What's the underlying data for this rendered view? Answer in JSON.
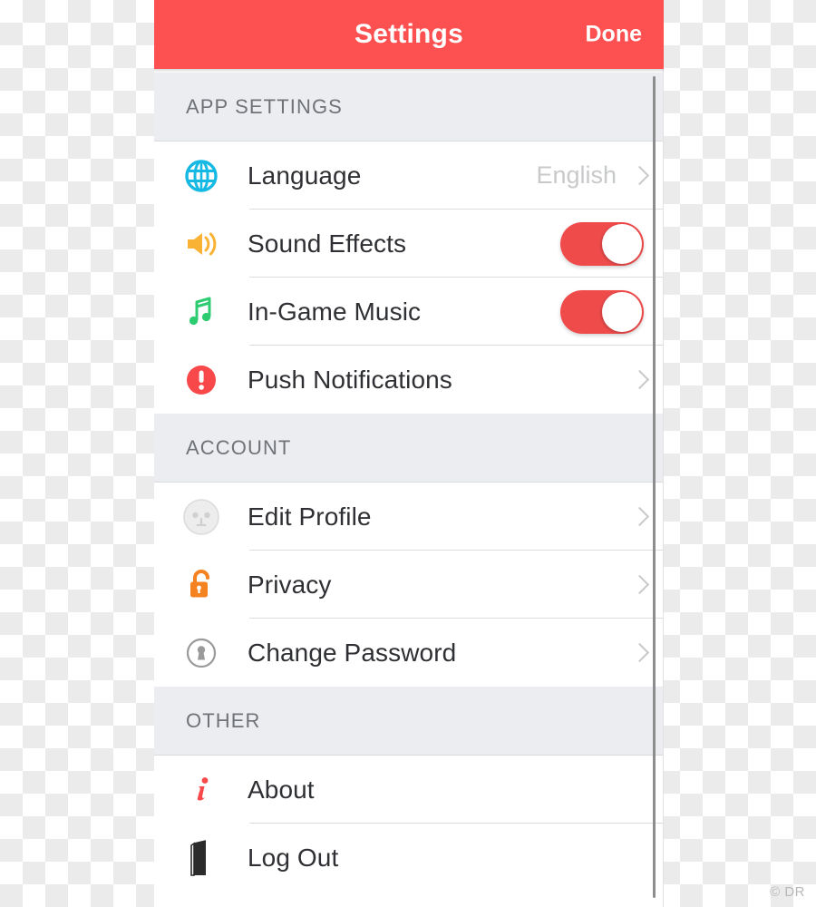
{
  "header": {
    "title": "Settings",
    "done_label": "Done",
    "bar_color": "#fc5150"
  },
  "sections": [
    {
      "label": "APP SETTINGS",
      "rows": [
        {
          "label": "Language",
          "icon": "globe-icon",
          "icon_color": "#15b9e3",
          "value": "English",
          "accessory": "chevron"
        },
        {
          "label": "Sound Effects",
          "icon": "speaker-icon",
          "icon_color": "#f9b233",
          "value": "",
          "accessory": "toggle",
          "toggle_on": true
        },
        {
          "label": "In-Game Music",
          "icon": "music-note-icon",
          "icon_color": "#2ecc71",
          "value": "",
          "accessory": "toggle",
          "toggle_on": true
        },
        {
          "label": "Push Notifications",
          "icon": "alert-circle-icon",
          "icon_color": "#f8484a",
          "value": "",
          "accessory": "chevron"
        }
      ]
    },
    {
      "label": "ACCOUNT",
      "rows": [
        {
          "label": "Edit Profile",
          "icon": "avatar-face-icon",
          "icon_color": "#e6e6e6",
          "value": "",
          "accessory": "chevron"
        },
        {
          "label": "Privacy",
          "icon": "open-padlock-icon",
          "icon_color": "#f58220",
          "value": "",
          "accessory": "chevron"
        },
        {
          "label": "Change Password",
          "icon": "keyhole-circle-icon",
          "icon_color": "#9a9a9a",
          "value": "",
          "accessory": "chevron"
        }
      ]
    },
    {
      "label": "OTHER",
      "rows": [
        {
          "label": "About",
          "icon": "info-italic-icon",
          "icon_color": "#f8484a",
          "value": "",
          "accessory": "none"
        },
        {
          "label": "Log Out",
          "icon": "exit-door-icon",
          "icon_color": "#2b2b2b",
          "value": "",
          "accessory": "none"
        }
      ]
    }
  ],
  "toggle_color": "#f04b4b",
  "watermark": "© DR"
}
